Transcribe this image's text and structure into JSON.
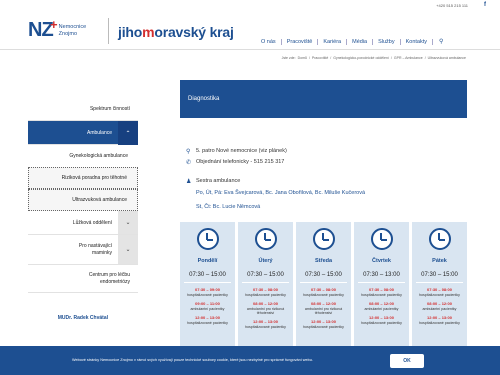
{
  "topbar": {
    "phone": "+420 515 215 111",
    "facebook_icon": "facebook-icon"
  },
  "logo": {
    "short": "NZ",
    "line1": "Nemocnice",
    "line2": "Znojmo"
  },
  "brand": {
    "part1": "jiho",
    "part2": "m",
    "part3": "oravský kraj"
  },
  "nav": [
    "O nás",
    "Pracoviště",
    "Kariéra",
    "Média",
    "Služby",
    "Kontakty"
  ],
  "breadcrumb": [
    "Jste zde:",
    "Domů",
    "/",
    "Pracoviště",
    "/",
    "Gynekologicko-porodnické oddělení",
    "/",
    "GPR – Ambulance",
    "/",
    "Ultrazvuková ambulance"
  ],
  "sidebar": {
    "spektrum": "Spektrum činností",
    "ambulance": "Ambulance",
    "sub": [
      "Gynekologická ambulance",
      "Riziková poradna pro těhotné",
      "Ultrazvuková ambulance"
    ],
    "luzkova": "Lůžková oddělení",
    "nastavajici": [
      "Pro nastávající",
      "maminky"
    ],
    "centrum": [
      "Centrum pro léčbu",
      "endometriózy"
    ],
    "doctor": "MUDr. Radek Chvátal"
  },
  "main": {
    "header": "Diagnostika",
    "location": "5. patro Nové nemocnice (viz plánek)",
    "phone": "Objednání telefonicky - 515 215 317",
    "nurses_title": "Sestra ambulance",
    "nurses_line1": "Po, Út, Pá: Eva Švejcarová, Bc. Jana Obořilová, Bc. Miluše Kučerová",
    "nurses_line2": "St, Čt: Bc. Lucie Němcová"
  },
  "schedule": [
    {
      "day": "Pondělí",
      "hours": "07:30 – 15:00",
      "slots": [
        {
          "time": "07:30 – 09:00",
          "desc": "hospitalizované pacientky"
        },
        {
          "time": "09:00 – 11:00",
          "desc": "ambulantní pacientky"
        },
        {
          "time": "12:00 – 13:00",
          "desc": "hospitalizované pacientky"
        }
      ]
    },
    {
      "day": "Úterý",
      "hours": "07:30 – 15:00",
      "slots": [
        {
          "time": "07:30 – 08:00",
          "desc": "hospitalizované pacientky"
        },
        {
          "time": "08:00 – 12:00",
          "desc": "ambulantní pro riziková těhotenství"
        },
        {
          "time": "12:00 – 13:00",
          "desc": "hospitalizované pacientky"
        }
      ]
    },
    {
      "day": "Středa",
      "hours": "07:30 – 15:00",
      "slots": [
        {
          "time": "07:30 – 08:00",
          "desc": "hospitalizované pacientky"
        },
        {
          "time": "08:00 – 12:00",
          "desc": "ambulantní pro riziková těhotenství"
        },
        {
          "time": "12:00 – 13:00",
          "desc": "hospitalizované pacientky"
        }
      ]
    },
    {
      "day": "Čtvrtek",
      "hours": "07:30 – 13:00",
      "slots": [
        {
          "time": "07:30 – 08:00",
          "desc": "hospitalizované pacientky"
        },
        {
          "time": "08:00 – 12:00",
          "desc": "ambulantní pacientky"
        },
        {
          "time": "12:00 – 13:00",
          "desc": "hospitalizované pacientky"
        }
      ]
    },
    {
      "day": "Pátek",
      "hours": "07:30 – 15:00",
      "slots": [
        {
          "time": "07:30 – 08:00",
          "desc": "hospitalizované pacientky"
        },
        {
          "time": "08:00 – 12:00",
          "desc": "ambulantní pacientky"
        },
        {
          "time": "12:00 – 13:00",
          "desc": "hospitalizované pacientky"
        }
      ]
    }
  ],
  "cookie": {
    "message": "Webové stránky Nemocnice Znojmo v rámci svých využívají pouze technické soubory cookie, které jsou nezbytné pro správné fungování webu.",
    "ok": "OK"
  },
  "colors": {
    "brand": "#1d4f91",
    "accent": "#d32f2f",
    "schedule_bg": "#d9e5f1"
  }
}
